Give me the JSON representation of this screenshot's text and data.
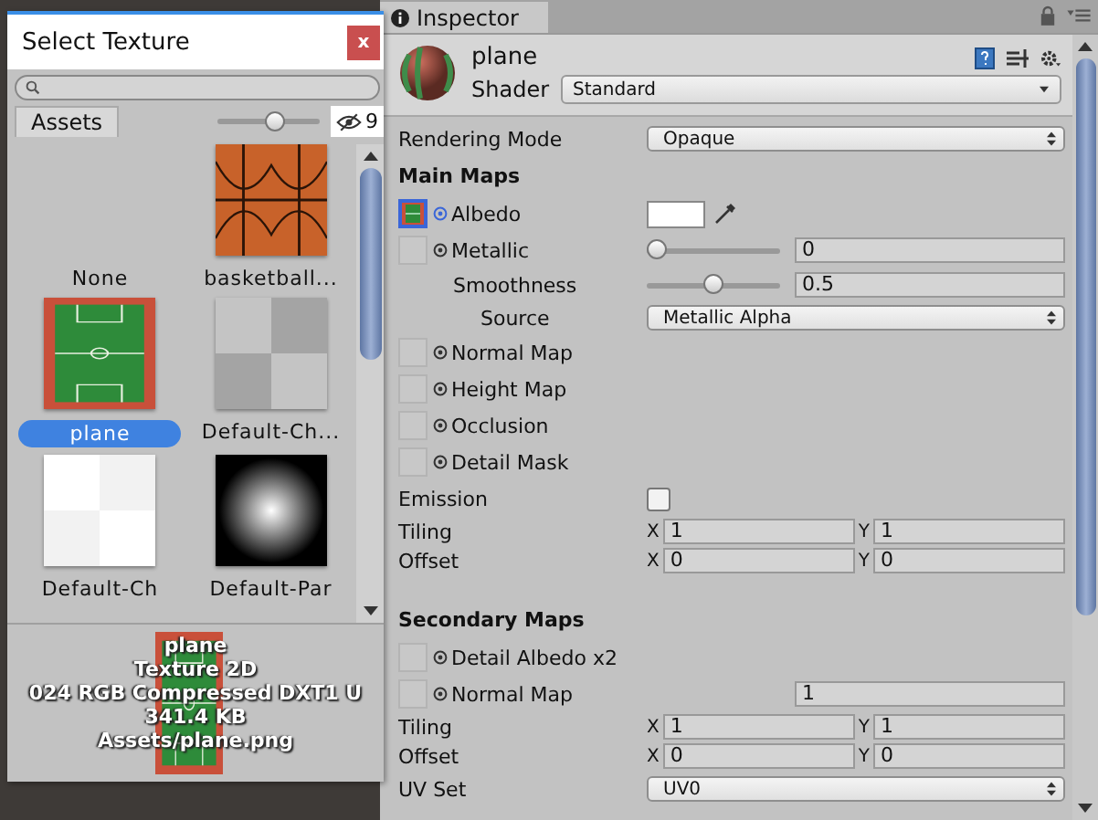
{
  "picker": {
    "title": "Select Texture",
    "close": "x",
    "tabs": [
      {
        "label": "Assets",
        "selected": true
      }
    ],
    "zoom": {
      "level": 0.6
    },
    "hidden_count": "9",
    "items": [
      {
        "label": "None",
        "kind": "none",
        "selected": false
      },
      {
        "label": "basketball...",
        "kind": "basketball",
        "selected": false
      },
      {
        "label": "plane",
        "kind": "court",
        "selected": true
      },
      {
        "label": "Default-Ch...",
        "kind": "checker_gray",
        "selected": false
      },
      {
        "label": "Default-Ch",
        "kind": "checker_white",
        "selected": false
      },
      {
        "label": "Default-Par",
        "kind": "radial",
        "selected": false
      }
    ],
    "preview": {
      "kind": "court",
      "lines": [
        "plane",
        "Texture 2D",
        "024  RGB Compressed DXT1 U",
        "341.4 KB",
        "Assets/plane.png"
      ]
    }
  },
  "inspector": {
    "tab": "Inspector",
    "material": "plane",
    "shader_label": "Shader",
    "shader": "Standard",
    "rows": [
      {
        "kind": "dropdown",
        "label": "Rendering Mode",
        "value": "Opaque"
      },
      {
        "kind": "heading",
        "label": "Main Maps"
      },
      {
        "kind": "texture_color",
        "label": "Albedo",
        "assigned": true,
        "color": "#ffffff"
      },
      {
        "kind": "texture_slider",
        "label": "Metallic",
        "assigned": false,
        "level": 0,
        "value": "0"
      },
      {
        "kind": "sub_slider",
        "label": "Smoothness",
        "level": 0.5,
        "value": "0.5"
      },
      {
        "kind": "sub_dropdown",
        "label": "Source",
        "value": "Metallic Alpha"
      },
      {
        "kind": "texture",
        "label": "Normal Map",
        "assigned": false
      },
      {
        "kind": "texture",
        "label": "Height Map",
        "assigned": false
      },
      {
        "kind": "texture",
        "label": "Occlusion",
        "assigned": false
      },
      {
        "kind": "texture",
        "label": "Detail Mask",
        "assigned": false
      },
      {
        "kind": "checkbox",
        "label": "Emission",
        "checked": false
      },
      {
        "kind": "vector",
        "label": "Tiling",
        "fields": [
          {
            "axis": "X",
            "value": "1"
          },
          {
            "axis": "Y",
            "value": "1"
          }
        ]
      },
      {
        "kind": "vector",
        "label": "Offset",
        "fields": [
          {
            "axis": "X",
            "value": "0"
          },
          {
            "axis": "Y",
            "value": "0"
          }
        ]
      },
      {
        "kind": "heading",
        "label": "Secondary Maps"
      },
      {
        "kind": "texture",
        "label": "Detail Albedo x2",
        "assigned": false
      },
      {
        "kind": "texture_number",
        "label": "Normal Map",
        "assigned": false,
        "value": "1"
      },
      {
        "kind": "vector",
        "label": "Tiling",
        "fields": [
          {
            "axis": "X",
            "value": "1"
          },
          {
            "axis": "Y",
            "value": "1"
          }
        ]
      },
      {
        "kind": "vector",
        "label": "Offset",
        "fields": [
          {
            "axis": "X",
            "value": "0"
          },
          {
            "axis": "Y",
            "value": "0"
          }
        ]
      },
      {
        "kind": "dropdown",
        "label": "UV Set",
        "value": "UV0"
      }
    ]
  }
}
